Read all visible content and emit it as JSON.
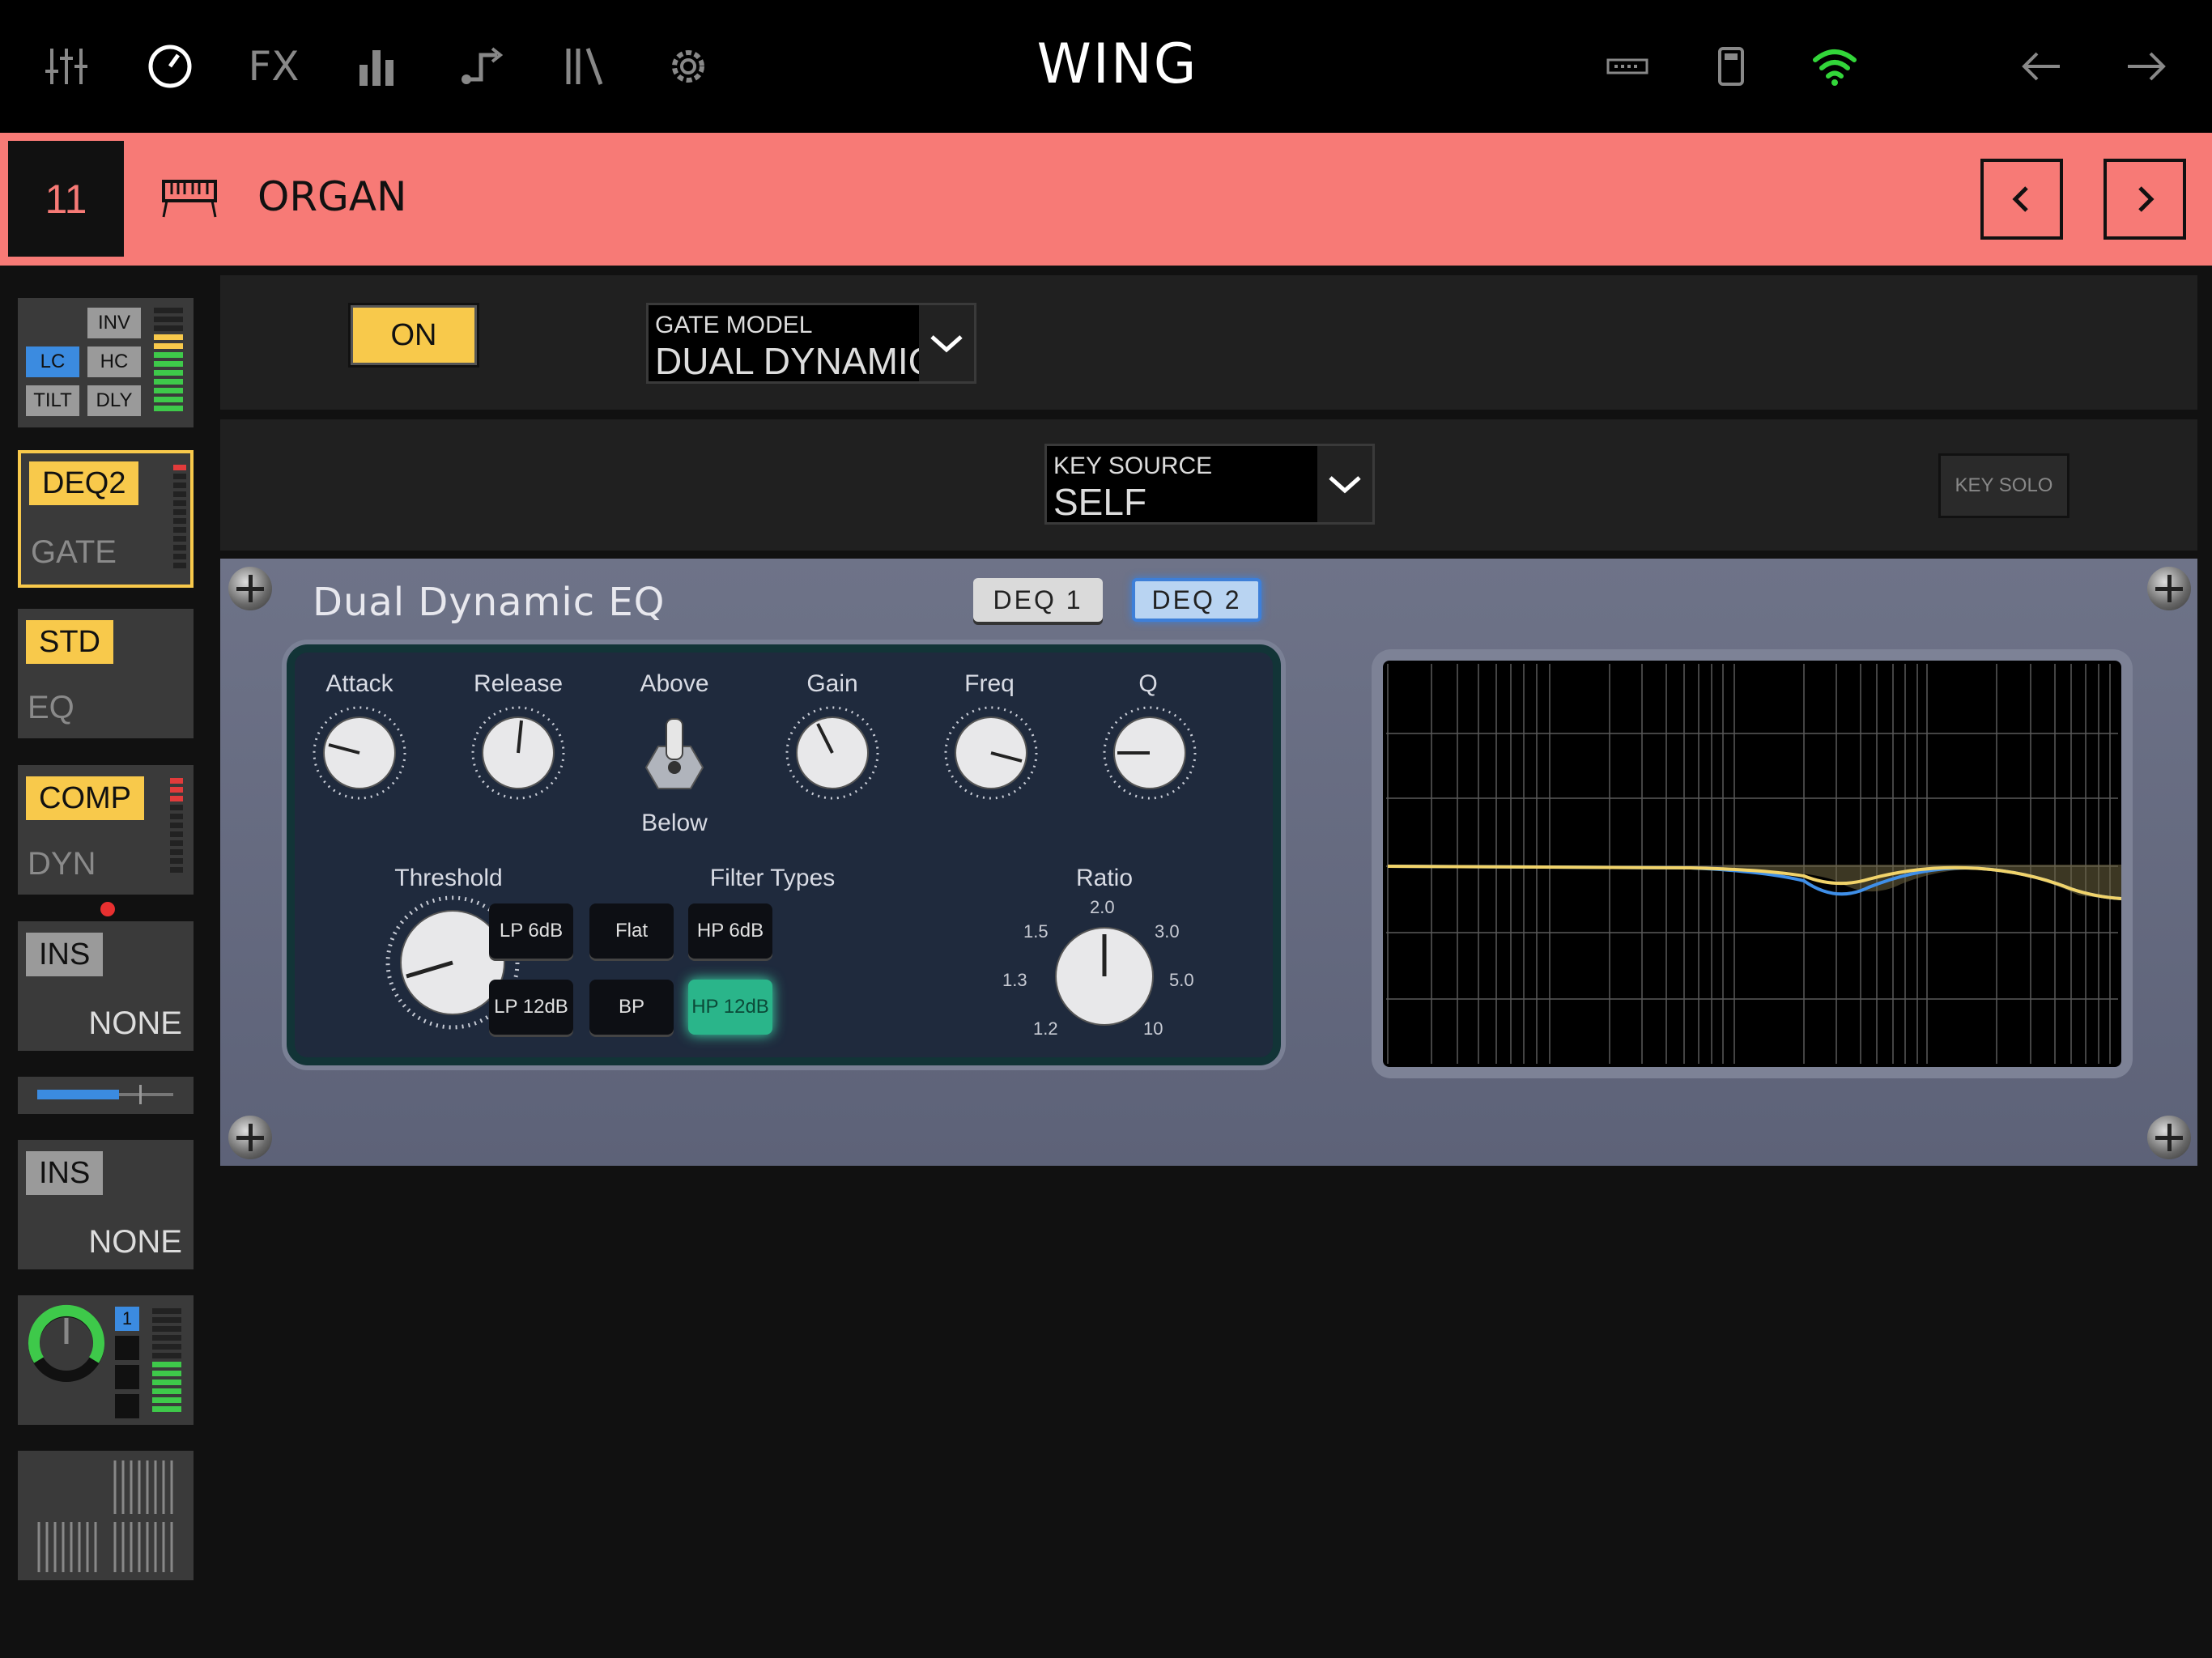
{
  "topbar": {
    "title": "WING",
    "left_icons": [
      "mixer-icon",
      "meter-dial-icon",
      "fx-icon",
      "bars-icon",
      "routing-icon",
      "library-icon",
      "settings-gear-icon"
    ],
    "right_icons": [
      "card-icon",
      "usb-icon",
      "wifi-icon",
      "back-arrow-icon",
      "forward-arrow-icon"
    ],
    "fx_label": "FX",
    "wifi_color": "#33d63a"
  },
  "channel": {
    "number": "11",
    "name": "ORGAN",
    "icon": "keyboard-icon",
    "color": "#f77a76"
  },
  "sidebar": {
    "filter_block": {
      "inv": "INV",
      "lc": "LC",
      "hc": "HC",
      "tilt": "TILT",
      "dly": "DLY"
    },
    "gate": {
      "tag": "DEQ2",
      "sub": "GATE"
    },
    "eq": {
      "tag": "STD",
      "sub": "EQ"
    },
    "dyn": {
      "tag": "COMP",
      "sub": "DYN"
    },
    "ins1": {
      "tag": "INS",
      "value": "NONE"
    },
    "ins2": {
      "tag": "INS",
      "value": "NONE"
    },
    "main_badge": "1",
    "send_level": 0.6
  },
  "gate_row": {
    "on_label": "ON",
    "model_label": "GATE MODEL",
    "model_value": "DUAL DYNAMIC"
  },
  "key_row": {
    "source_label": "KEY SOURCE",
    "source_value": "SELF",
    "solo_label": "KEY SOLO"
  },
  "plugin": {
    "title": "Dual Dynamic EQ",
    "deq1": "DEQ  1",
    "deq2": "DEQ  2",
    "knobs": {
      "attack": "Attack",
      "release": "Release",
      "above": "Above",
      "below": "Below",
      "gain": "Gain",
      "freq": "Freq",
      "q": "Q",
      "threshold": "Threshold",
      "ratio": "Ratio"
    },
    "filter_types_label": "Filter Types",
    "filters": [
      "LP 6dB",
      "Flat",
      "HP 6dB",
      "LP 12dB",
      "BP",
      "HP 12dB"
    ],
    "active_filter": "HP 12dB",
    "ratio_ticks": {
      "t12": "1.2",
      "t13": "1.3",
      "t15": "1.5",
      "t20": "2.0",
      "t30": "3.0",
      "t50": "5.0",
      "t10": "10"
    }
  }
}
